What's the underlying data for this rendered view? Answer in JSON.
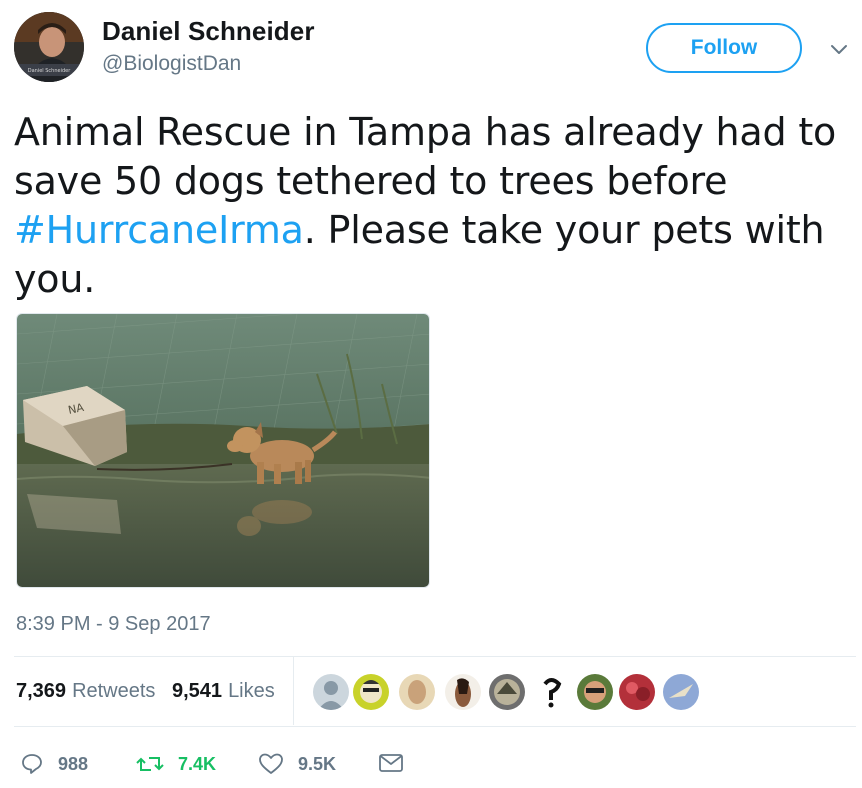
{
  "author": {
    "display_name": "Daniel Schneider",
    "handle": "@BiologistDan",
    "avatar_caption": "Daniel Schneider"
  },
  "header": {
    "follow_label": "Follow"
  },
  "tweet": {
    "text_before": "Animal Rescue in Tampa has already had to save 50 dogs tethered to trees before ",
    "hashtag": "#HurrcaneIrma",
    "text_after": ". Please take your pets with you.",
    "timestamp": "8:39 PM - 9 Sep 2017"
  },
  "media": {
    "sign_text": "NA"
  },
  "stats": {
    "retweets_count": "7,369",
    "retweets_label": "Retweets",
    "likes_count": "9,541",
    "likes_label": "Likes"
  },
  "actions": {
    "reply_count": "988",
    "retweet_count": "7.4K",
    "like_count": "9.5K"
  },
  "colors": {
    "accent": "#1da1f2",
    "muted": "#657786",
    "retweet_green": "#17bf63"
  }
}
